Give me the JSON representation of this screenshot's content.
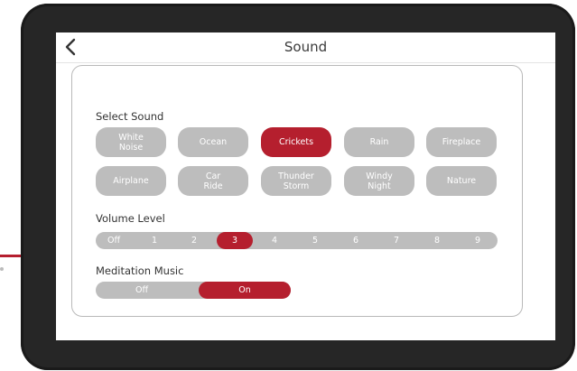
{
  "header": {
    "title": "Sound"
  },
  "select_sound": {
    "label": "Select Sound",
    "options": [
      "White\nNoise",
      "Ocean",
      "Crickets",
      "Rain",
      "Fireplace",
      "Airplane",
      "Car\nRide",
      "Thunder\nStorm",
      "Windy\nNight",
      "Nature"
    ],
    "selected": "Crickets"
  },
  "volume": {
    "label": "Volume Level",
    "levels": [
      "Off",
      "1",
      "2",
      "3",
      "4",
      "5",
      "6",
      "7",
      "8",
      "9"
    ],
    "selected": "3"
  },
  "meditation": {
    "label": "Meditation Music",
    "options": [
      "Off",
      "On"
    ],
    "selected": "On"
  },
  "colors": {
    "accent": "#b51f2e",
    "inactive": "#bdbdbd",
    "device": "#262626"
  }
}
